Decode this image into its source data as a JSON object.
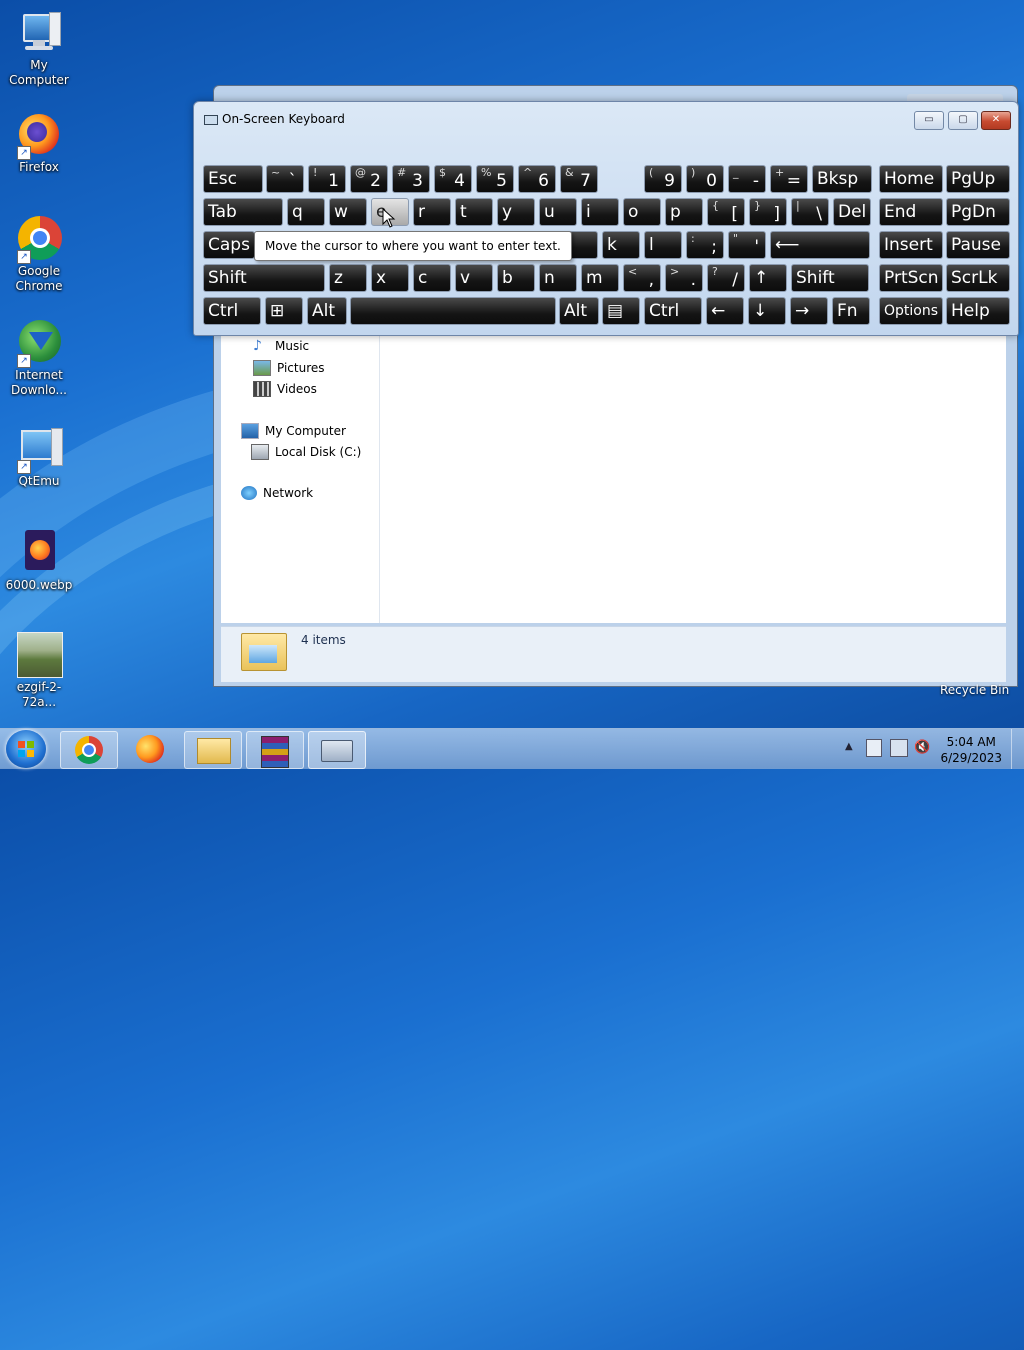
{
  "desktop": {
    "icons": [
      {
        "label": "My Computer"
      },
      {
        "label": "Firefox"
      },
      {
        "label": "Google Chrome"
      },
      {
        "label": "Internet Downlo..."
      },
      {
        "label": "QtEmu"
      },
      {
        "label": "6000.webp"
      },
      {
        "label": "ezgif-2-72a..."
      }
    ],
    "recycle_bin_label": "Recycle Bin"
  },
  "explorer": {
    "nav": {
      "music": "Music",
      "pictures": "Pictures",
      "videos": "Videos",
      "my_computer": "My Computer",
      "local_disk": "Local Disk (C:)",
      "network": "Network"
    },
    "details": {
      "item_count": "4 items"
    }
  },
  "osk": {
    "title": "On-Screen Keyboard",
    "window_buttons": {
      "minimize": "▭",
      "restore": "▢",
      "close": "✕"
    },
    "tooltip": "Move the cursor to where you want to enter text.",
    "rows": [
      [
        {
          "label": "Esc"
        },
        {
          "top": "~",
          "bot": "`"
        },
        {
          "top": "!",
          "bot": "1"
        },
        {
          "top": "@",
          "bot": "2"
        },
        {
          "top": "#",
          "bot": "3"
        },
        {
          "top": "$",
          "bot": "4"
        },
        {
          "top": "%",
          "bot": "5"
        },
        {
          "top": "^",
          "bot": "6"
        },
        {
          "top": "&",
          "bot": "7"
        },
        {
          "top": "(",
          "bot": "9"
        },
        {
          "top": ")",
          "bot": "0"
        },
        {
          "top": "_",
          "bot": "-"
        },
        {
          "top": "+",
          "bot": "="
        },
        {
          "label": "Bksp"
        },
        {
          "label": "Home"
        },
        {
          "label": "PgUp"
        }
      ],
      [
        {
          "label": "Tab"
        },
        {
          "label": "q"
        },
        {
          "label": "w"
        },
        {
          "label": "e",
          "highlighted": true
        },
        {
          "label": "r"
        },
        {
          "label": "t"
        },
        {
          "label": "y"
        },
        {
          "label": "u"
        },
        {
          "label": "i"
        },
        {
          "label": "o"
        },
        {
          "label": "p"
        },
        {
          "top": "{",
          "bot": "["
        },
        {
          "top": "}",
          "bot": "]"
        },
        {
          "top": "|",
          "bot": "\\"
        },
        {
          "label": "Del"
        },
        {
          "label": "End"
        },
        {
          "label": "PgDn"
        }
      ],
      [
        {
          "label": "Caps"
        },
        {
          "label": "j"
        },
        {
          "label": "k"
        },
        {
          "label": "l"
        },
        {
          "top": ":",
          "bot": ";"
        },
        {
          "top": "\"",
          "bot": "'"
        },
        {
          "label": "⟵"
        },
        {
          "label": "Insert"
        },
        {
          "label": "Pause"
        }
      ],
      [
        {
          "label": "Shift"
        },
        {
          "label": "z"
        },
        {
          "label": "x"
        },
        {
          "label": "c"
        },
        {
          "label": "v"
        },
        {
          "label": "b"
        },
        {
          "label": "n"
        },
        {
          "label": "m"
        },
        {
          "top": "<",
          "bot": ","
        },
        {
          "top": ">",
          "bot": "."
        },
        {
          "top": "?",
          "bot": "/"
        },
        {
          "label": "↑"
        },
        {
          "label": "Shift"
        },
        {
          "label": "PrtScn"
        },
        {
          "label": "ScrLk"
        }
      ],
      [
        {
          "label": "Ctrl"
        },
        {
          "label": "⊞"
        },
        {
          "label": "Alt"
        },
        {
          "label": ""
        },
        {
          "label": "Alt"
        },
        {
          "label": "▤"
        },
        {
          "label": "Ctrl"
        },
        {
          "label": "←"
        },
        {
          "label": "↓"
        },
        {
          "label": "→"
        },
        {
          "label": "Fn"
        },
        {
          "label": "Options"
        },
        {
          "label": "Help"
        }
      ]
    ]
  },
  "taskbar": {
    "clock_time": "5:04 AM",
    "clock_date": "6/29/2023"
  },
  "colors": {
    "desktop_blue": "#1a6fd0",
    "key_bg": "#151515",
    "close_red": "#c74a30"
  }
}
